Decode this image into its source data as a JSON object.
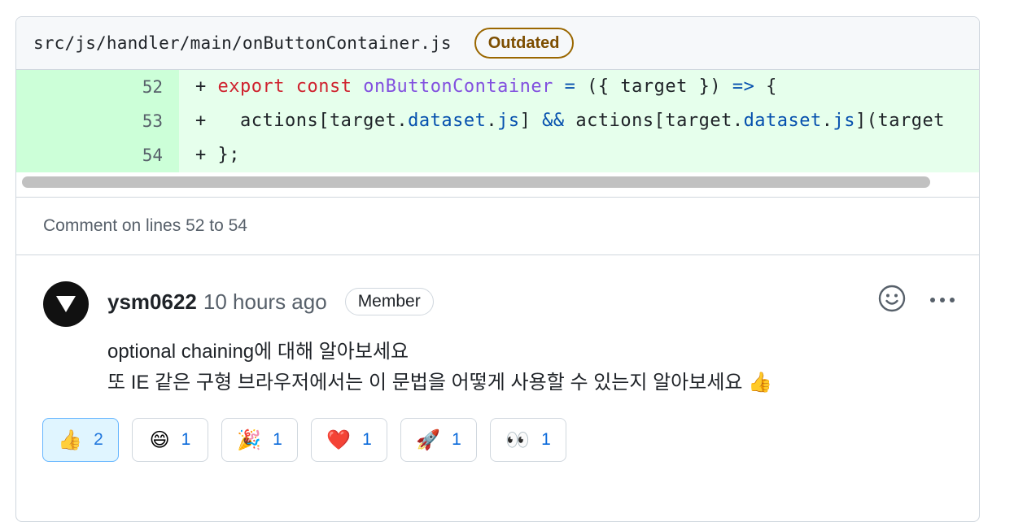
{
  "file": {
    "path": "src/js/handler/main/onButtonContainer.js",
    "badge": "Outdated"
  },
  "code": {
    "lines": [
      {
        "num": "52",
        "text": "+ export const onButtonContainer = ({ target }) => {"
      },
      {
        "num": "53",
        "text": "+   actions[target.dataset.js] && actions[target.dataset.js](target"
      },
      {
        "num": "54",
        "text": "+ };"
      }
    ]
  },
  "comment_on": "Comment on lines 52 to 54",
  "comment": {
    "author": "ysm0622",
    "time": "10 hours ago",
    "role_badge": "Member",
    "body_line1": "optional chaining에 대해 알아보세요",
    "body_line2": "또 IE 같은 구형 브라우저에서는 이 문법을 어떻게 사용할 수 있는지 알아보세요 👍"
  },
  "reactions": [
    {
      "emoji": "👍",
      "count": "2",
      "name": "thumbs-up"
    },
    {
      "emoji": "😄",
      "count": "1",
      "name": "smile"
    },
    {
      "emoji": "🎉",
      "count": "1",
      "name": "tada"
    },
    {
      "emoji": "❤️",
      "count": "1",
      "name": "heart"
    },
    {
      "emoji": "🚀",
      "count": "1",
      "name": "rocket"
    },
    {
      "emoji": "👀",
      "count": "1",
      "name": "eyes"
    }
  ],
  "icons": {
    "add_reaction": "smiley-icon",
    "more": "kebab-horizontal-icon"
  }
}
